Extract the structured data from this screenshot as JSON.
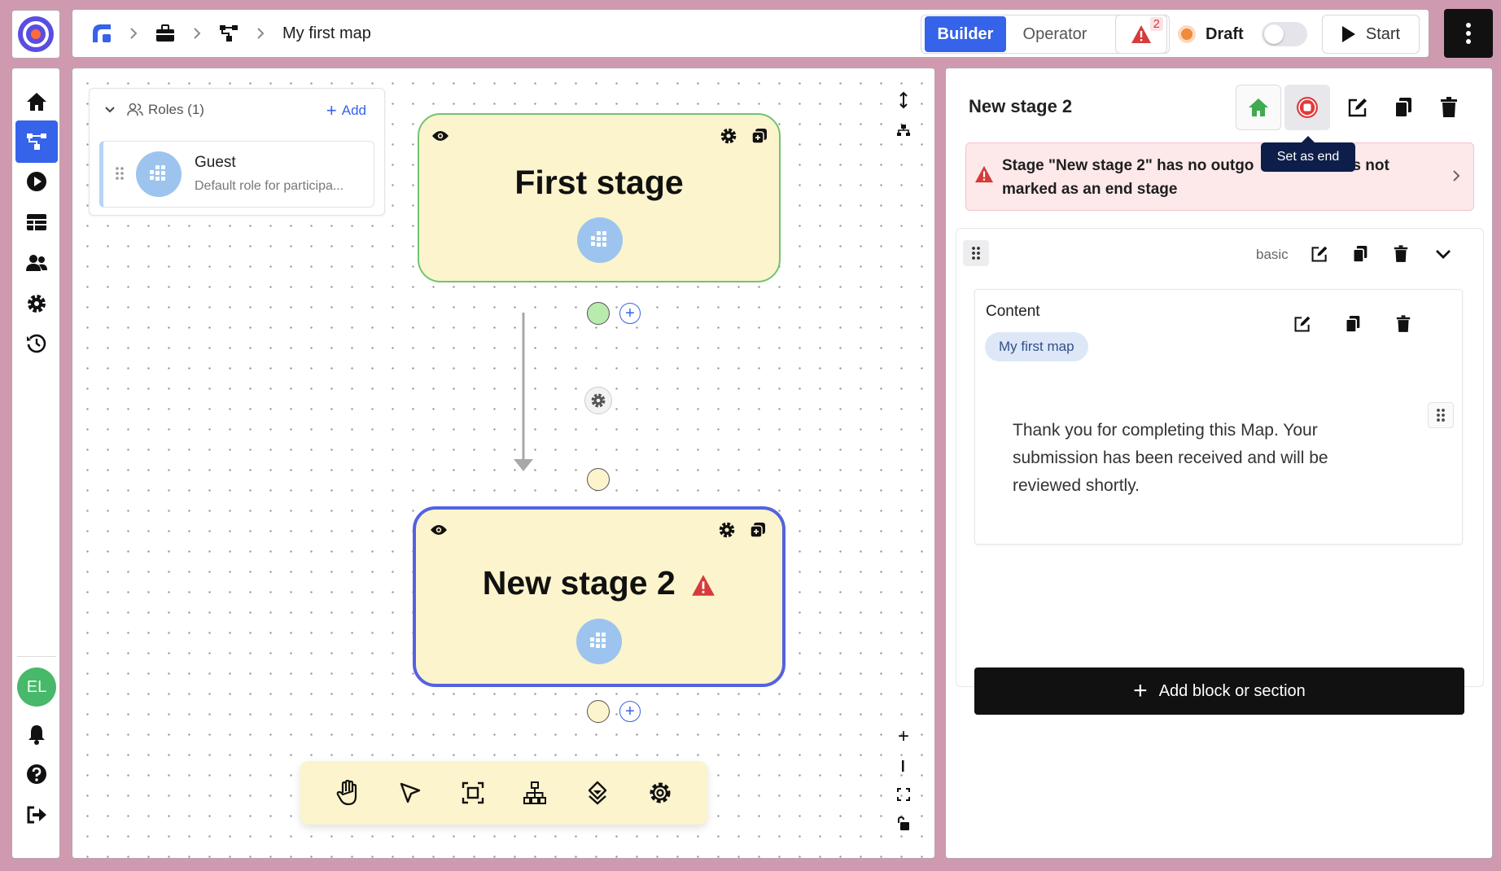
{
  "app": {
    "logo_icon": "app-logo-icon"
  },
  "breadcrumb": {
    "items": [
      {
        "icon": "home-logo-icon"
      },
      {
        "icon": "briefcase-icon"
      },
      {
        "icon": "map-flow-icon"
      }
    ],
    "current": "My first map"
  },
  "header": {
    "mode_builder": "Builder",
    "mode_operator": "Operator",
    "active_mode": "Builder",
    "warning_count": "2",
    "status_label": "Draft",
    "status_toggle_on": false,
    "start_label": "Start"
  },
  "sidebar": {
    "items": [
      {
        "name": "home",
        "icon": "home-icon",
        "active": false
      },
      {
        "name": "maps",
        "icon": "map-flow-icon",
        "active": true
      },
      {
        "name": "run",
        "icon": "play-circle-icon",
        "active": false
      },
      {
        "name": "tables",
        "icon": "table-icon",
        "active": false
      },
      {
        "name": "users",
        "icon": "users-icon",
        "active": false
      },
      {
        "name": "settings",
        "icon": "gear-icon",
        "active": false
      },
      {
        "name": "history",
        "icon": "history-icon",
        "active": false
      }
    ],
    "avatar_initials": "EL",
    "bottom": [
      {
        "name": "notifications",
        "icon": "bell-icon"
      },
      {
        "name": "help",
        "icon": "help-icon"
      },
      {
        "name": "logout",
        "icon": "logout-icon"
      }
    ]
  },
  "canvas": {
    "roles": {
      "header": "Roles (1)",
      "add_label": "Add",
      "items": [
        {
          "name": "Guest",
          "description": "Default role for participa..."
        }
      ]
    },
    "stages": [
      {
        "title": "First stage",
        "selected": false,
        "warning": false
      },
      {
        "title": "New stage 2",
        "selected": true,
        "warning": true
      }
    ],
    "toolbar": [
      "hand-icon",
      "pointer-icon",
      "frame-icon",
      "tree-icon",
      "layers-icon",
      "gear-icon"
    ]
  },
  "panel": {
    "title": "New stage 2",
    "tooltip": "Set as end",
    "alert": "Stage \"New stage 2\" has no outgo           ons but is not marked as an end stage",
    "block": {
      "type": "basic",
      "content_label": "Content",
      "chip": "My first map",
      "text": "Thank you for completing this Map. Your submission has been received and will be reviewed shortly."
    },
    "add_block_label": "Add block or section"
  },
  "colors": {
    "brand": "#3563e9",
    "stage_fill": "#fbf4cc",
    "stage_border_first": "#72c372",
    "stage_border_selected": "#5462e0",
    "alert_bg": "#fde8ea",
    "danger": "#d63b3b",
    "home_green": "#3faa4e",
    "draft_orange": "#f08a3c"
  }
}
